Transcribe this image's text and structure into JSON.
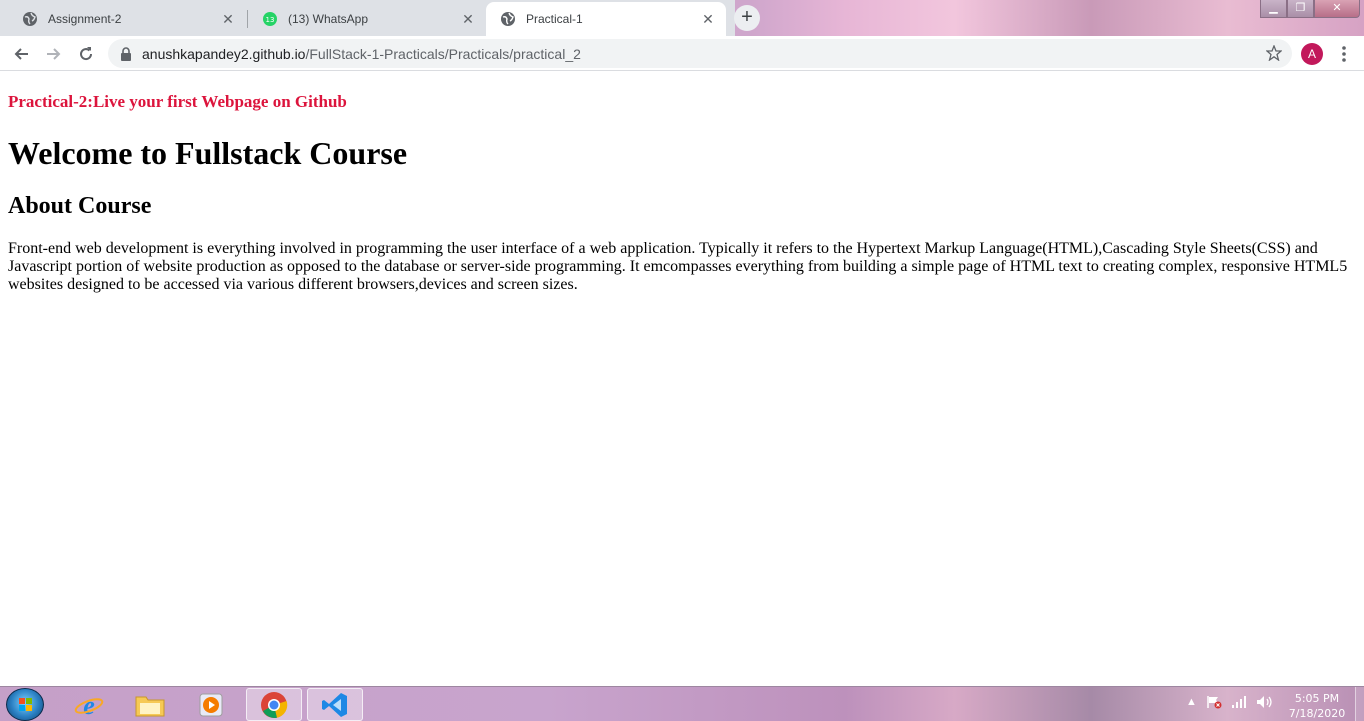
{
  "browser": {
    "tabs": [
      {
        "title": "Assignment-2",
        "icon": "globe-icon",
        "active": false
      },
      {
        "title": "(13) WhatsApp",
        "icon": "whatsapp-icon",
        "badge": "13",
        "active": false
      },
      {
        "title": "Practical-1",
        "icon": "globe-icon",
        "active": true
      }
    ],
    "close_glyph": "✕",
    "new_tab_glyph": "+",
    "url_host": "anushkapandey2.github.io",
    "url_path": "/FullStack-1-Practicals/Practicals/practical_2",
    "profile_initial": "A",
    "accent": "#c2185b"
  },
  "page": {
    "subtitle": "Practical-2:Live your first Webpage on Github",
    "heading": "Welcome to Fullstack Course",
    "section_heading": "About Course",
    "paragraph": "Front-end web development is everything involved in programming the user interface of a web application. Typically it refers to the Hypertext Markup Language(HTML),Cascading Style Sheets(CSS) and Javascript portion of website production as opposed to the database or server-side programming. It emcompasses everything from building a simple page of HTML text to creating complex, responsive HTML5 websites designed to be accessed via various different browsers,devices and screen sizes.",
    "subtitle_color": "#dc143c"
  },
  "taskbar": {
    "apps": [
      "windows-start-icon",
      "internet-explorer-icon",
      "file-explorer-icon",
      "media-player-icon",
      "chrome-icon",
      "vscode-icon"
    ],
    "time": "5:05 PM",
    "date": "7/18/2020"
  }
}
